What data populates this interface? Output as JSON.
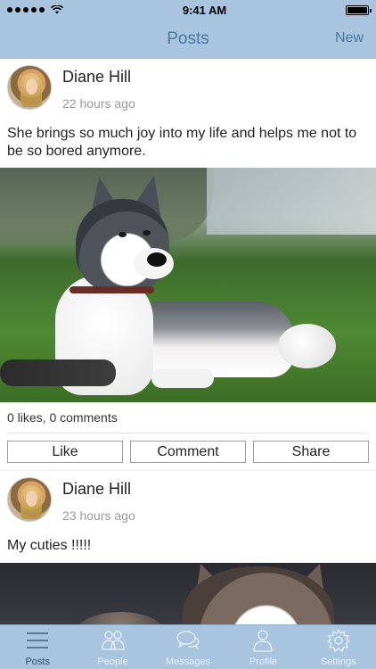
{
  "status_bar": {
    "time": "9:41 AM"
  },
  "nav": {
    "title": "Posts",
    "right_action": "New"
  },
  "posts": [
    {
      "author": "Diane Hill",
      "time": "22 hours ago",
      "text": "She brings so much joy into my life and helps me not to be so bored anymore.",
      "stats": "0 likes, 0 comments",
      "actions": [
        "Like",
        "Comment",
        "Share"
      ]
    },
    {
      "author": "Diane Hill",
      "time": "23 hours ago",
      "text": "My cuties !!!!!"
    }
  ],
  "tabs": [
    {
      "label": "Posts",
      "icon": "list-icon",
      "active": true
    },
    {
      "label": "People",
      "icon": "people-icon",
      "active": false
    },
    {
      "label": "Messages",
      "icon": "chat-bubbles-icon",
      "active": false
    },
    {
      "label": "Profile",
      "icon": "person-icon",
      "active": false
    },
    {
      "label": "Settings",
      "icon": "gear-icon",
      "active": false
    }
  ],
  "colors": {
    "bar_background": "#a9c5de",
    "nav_text": "#4a78a4",
    "tab_label_active": "#2f4d6c",
    "tab_label_inactive": "#e9f1f8"
  }
}
